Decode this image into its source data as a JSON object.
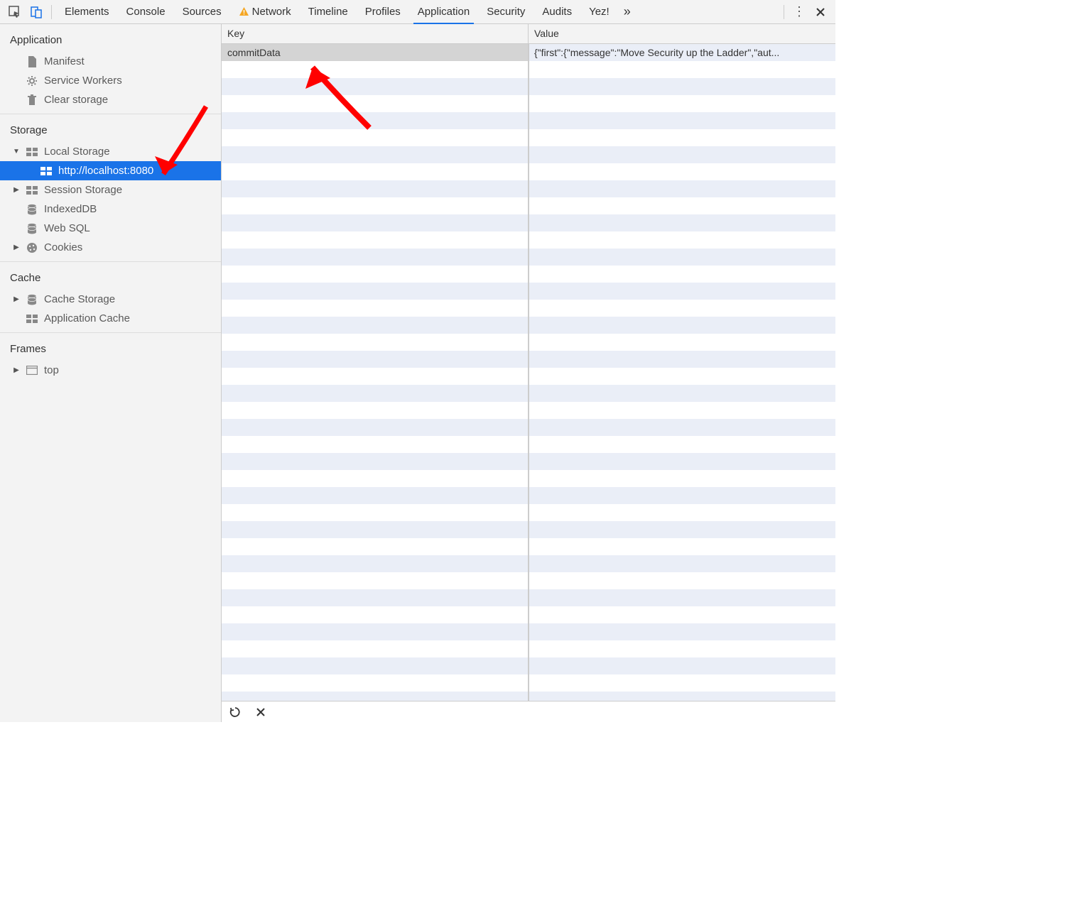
{
  "toolbar": {
    "tabs": [
      {
        "label": "Elements"
      },
      {
        "label": "Console"
      },
      {
        "label": "Sources"
      },
      {
        "label": "Network",
        "warning": true
      },
      {
        "label": "Timeline"
      },
      {
        "label": "Profiles"
      },
      {
        "label": "Application",
        "active": true
      },
      {
        "label": "Security"
      },
      {
        "label": "Audits"
      },
      {
        "label": "Yez!"
      }
    ]
  },
  "sidebar": {
    "sections": [
      {
        "title": "Application",
        "items": [
          {
            "label": "Manifest",
            "icon": "document-icon"
          },
          {
            "label": "Service Workers",
            "icon": "gear-icon"
          },
          {
            "label": "Clear storage",
            "icon": "trash-icon"
          }
        ]
      },
      {
        "title": "Storage",
        "items": [
          {
            "label": "Local Storage",
            "icon": "grid-icon",
            "disclosure": "open",
            "children": [
              {
                "label": "http://localhost:8080",
                "icon": "grid-icon",
                "selected": true
              }
            ]
          },
          {
            "label": "Session Storage",
            "icon": "grid-icon",
            "disclosure": "closed"
          },
          {
            "label": "IndexedDB",
            "icon": "database-icon"
          },
          {
            "label": "Web SQL",
            "icon": "database-icon"
          },
          {
            "label": "Cookies",
            "icon": "cookie-icon",
            "disclosure": "closed"
          }
        ]
      },
      {
        "title": "Cache",
        "items": [
          {
            "label": "Cache Storage",
            "icon": "database-icon",
            "disclosure": "closed"
          },
          {
            "label": "Application Cache",
            "icon": "grid-icon"
          }
        ]
      },
      {
        "title": "Frames",
        "items": [
          {
            "label": "top",
            "icon": "window-icon",
            "disclosure": "closed"
          }
        ]
      }
    ]
  },
  "table": {
    "headers": {
      "key": "Key",
      "value": "Value"
    },
    "rows": [
      {
        "key": "commitData",
        "value": "{\"first\":{\"message\":\"Move Security up the Ladder\",\"aut...",
        "selected": true
      }
    ],
    "emptyRowCount": 38
  }
}
